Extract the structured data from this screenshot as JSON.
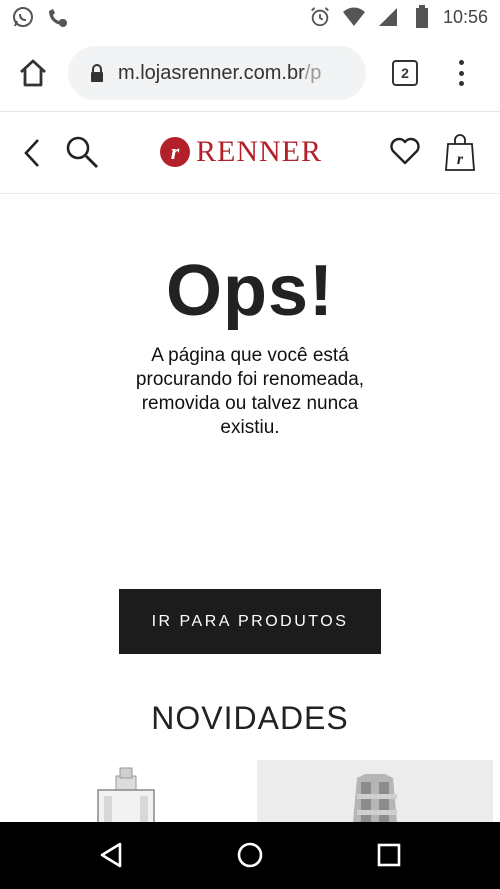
{
  "status_bar": {
    "time": "10:56",
    "icons": [
      "whatsapp-icon",
      "missed-call-icon",
      "alarm-icon",
      "wifi-icon",
      "signal-icon",
      "battery-icon"
    ]
  },
  "browser": {
    "url_main": "m.lojasrenner.com.br",
    "url_rest": "/p",
    "tab_count": "2"
  },
  "header": {
    "logo_text": "RENNER",
    "logo_letter": "r",
    "brand_color": "#b3202a"
  },
  "error": {
    "title": "Ops!",
    "message": "A página que você está procurando foi renomeada, removida ou talvez nunca existiu."
  },
  "cta": {
    "label": "IR PARA PRODUTOS"
  },
  "section": {
    "title": "NOVIDADES"
  },
  "products": [
    {
      "icon": "perfume-bottle-icon"
    },
    {
      "icon": "wristwatch-icon"
    }
  ],
  "colors": {
    "cta_background": "#1c1c1c",
    "nav_background": "#000000"
  }
}
